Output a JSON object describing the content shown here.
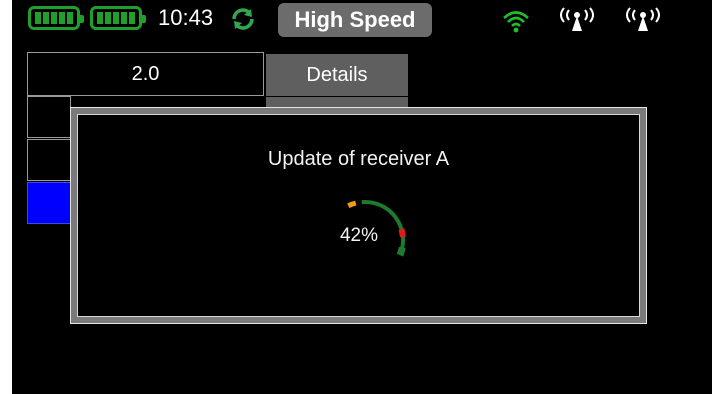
{
  "status_bar": {
    "time": "10:43",
    "mode_label": "High Speed",
    "icons": [
      "battery-icon",
      "battery-icon",
      "sync-icon",
      "wifi-icon",
      "antenna-icon",
      "antenna-icon"
    ],
    "colors": {
      "battery": "#1f9f2b",
      "sync": "#2fa84f",
      "wifi": "#1fbf2a",
      "badge": "#6c6c6c"
    }
  },
  "table": {
    "value": "2.0",
    "details_label": "Details",
    "selected_color": "#0000ff"
  },
  "modal": {
    "title": "Update of receiver  A",
    "progress_text": "42%",
    "progress": 0.42,
    "colors": {
      "arc": "#1e7a2c",
      "warn": "#f09a1a",
      "alert": "#e01b1b"
    }
  }
}
